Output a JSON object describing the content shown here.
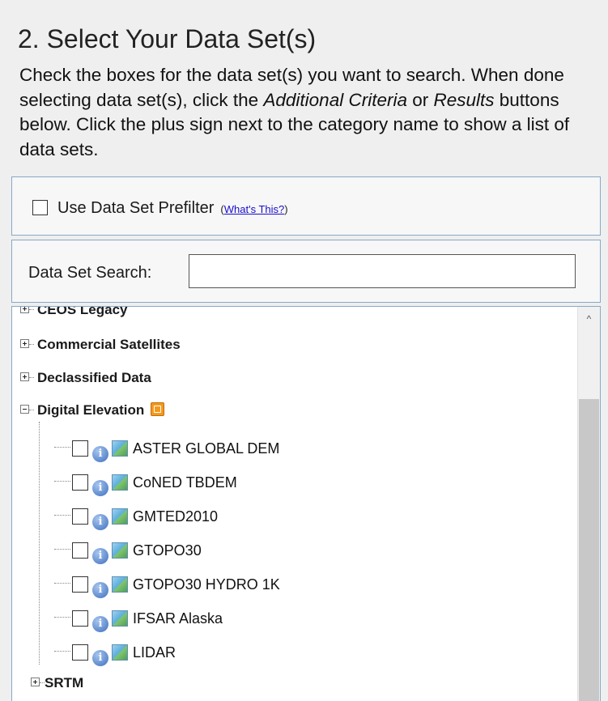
{
  "header": {
    "title": "2. Select Your Data Set(s)",
    "intro_part1": "Check the boxes for the data set(s) you want to search. When done selecting data set(s), click the ",
    "intro_em1": "Additional Criteria",
    "intro_part2": " or ",
    "intro_em2": "Results",
    "intro_part3": " buttons below. Click the plus sign next to the category name to show a list of data sets."
  },
  "prefilter": {
    "label": "Use Data Set Prefilter",
    "link_open": "(",
    "link_text": "What's This?",
    "link_close": ")",
    "checked": false
  },
  "search": {
    "label": "Data Set Search:",
    "value": "",
    "placeholder": ""
  },
  "tree": {
    "categories": {
      "ceos_legacy": "CEOS Legacy",
      "commercial_satellites": "Commercial Satellites",
      "declassified_data": "Declassified Data",
      "digital_elevation": "Digital Elevation",
      "srtm": "SRTM"
    },
    "digital_elevation_items": [
      "ASTER GLOBAL DEM",
      "CoNED TBDEM",
      "GMTED2010",
      "GTOPO30",
      "GTOPO30 HYDRO 1K",
      "IFSAR Alaska",
      "LIDAR"
    ],
    "icons": {
      "expand": "plus-expander-icon",
      "collapse": "minus-expander-icon",
      "info": "info-icon",
      "map": "map-thumbnail-icon",
      "feed": "feed-icon"
    }
  },
  "scrollbar": {
    "up_arrow": "^"
  }
}
